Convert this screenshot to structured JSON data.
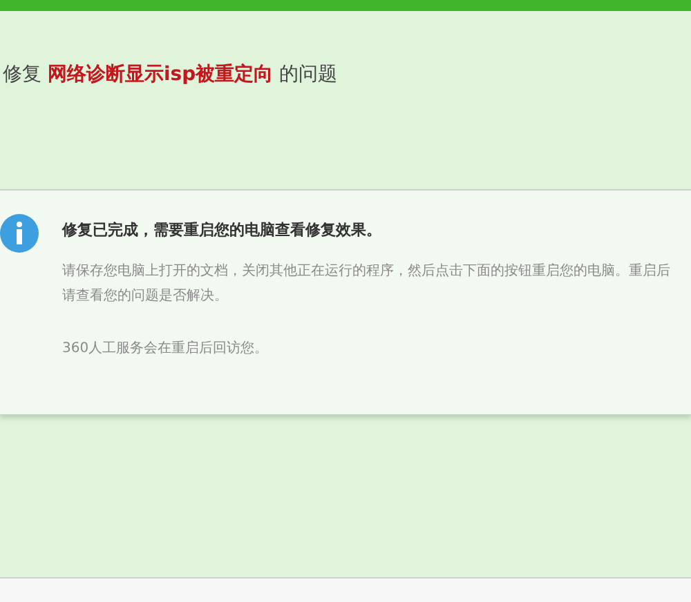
{
  "title": {
    "prefix": "修复",
    "highlight": "网络诊断显示isp被重定向",
    "suffix": "的问题"
  },
  "notice": {
    "heading": "修复已完成，需要重启您的电脑查看修复效果。",
    "body": "请保存您电脑上打开的文档，关闭其他正在运行的程序，然后点击下面的按钮重启您的电脑。重启后请查看您的问题是否解决。",
    "note": "360人工服务会在重启后回访您。"
  }
}
